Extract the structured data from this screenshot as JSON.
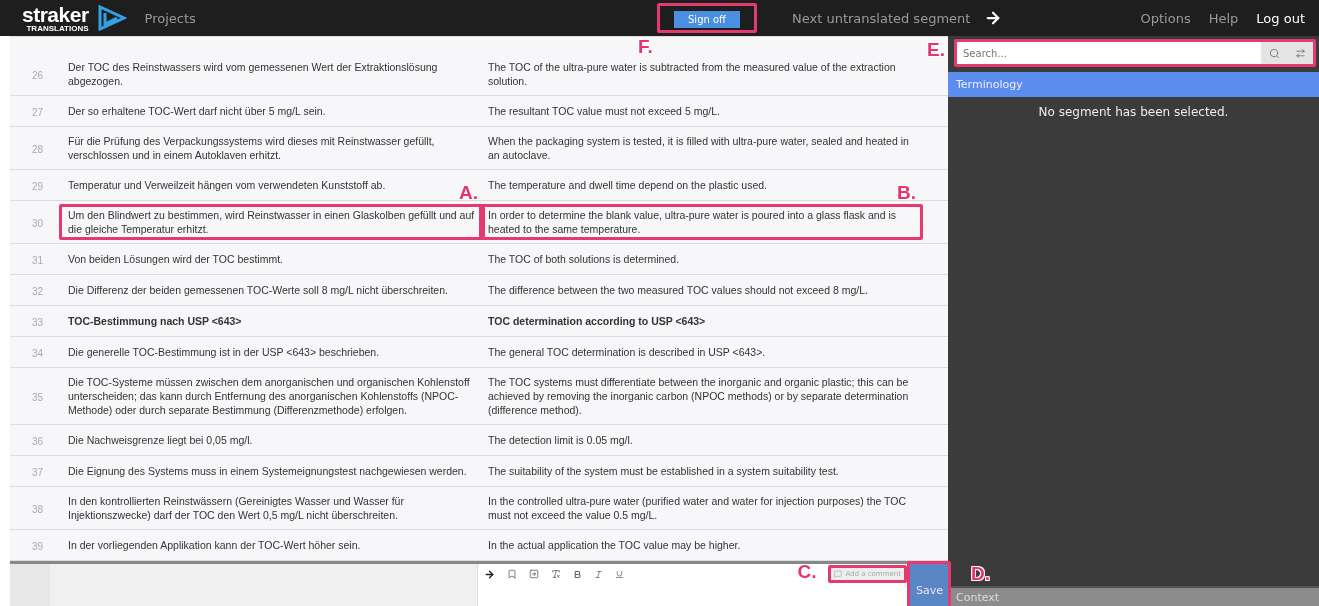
{
  "topbar": {
    "logo": {
      "name": "straker",
      "tagline": "TRANSLATIONS"
    },
    "projects": "Projects",
    "sign_off": {
      "label": "Sign off",
      "callout": "F."
    },
    "next": "Next untranslated segment",
    "menu": [
      {
        "label": "Options",
        "active": false
      },
      {
        "label": "Help",
        "active": false
      },
      {
        "label": "Log out",
        "active": true
      }
    ]
  },
  "segments": [
    {
      "number": "26",
      "source": "Der TOC des Reinstwassers wird vom gemessenen Wert der Extraktionslösung abgezogen.",
      "target": "The TOC of the ultra-pure water is subtracted from the measured value of the extraction solution.",
      "heading": false
    },
    {
      "number": "27",
      "source": "Der so erhaltene TOC-Wert darf nicht über 5 mg/L sein.",
      "target": "The resultant TOC value must not exceed 5 mg/L.",
      "heading": false
    },
    {
      "number": "28",
      "source": "Für die Prüfung des Verpackungssystems wird dieses mit Reinstwasser gefüllt, verschlossen und in einem Autoklaven erhitzt.",
      "target": "When the packaging system is tested, it is filled with ultra-pure water, sealed and heated in an autoclave.",
      "heading": false
    },
    {
      "number": "29",
      "source": "Temperatur und Verweilzeit hängen vom verwendeten Kunststoff ab.",
      "target": "The temperature and dwell time depend on the plastic used.",
      "heading": false
    },
    {
      "number": "30",
      "source": "Um den Blindwert zu bestimmen, wird Reinstwasser in einen Glaskolben gefüllt und auf die gleiche Temperatur erhitzt.",
      "target": "In order to determine the blank value, ultra-pure water is poured into a glass flask and is heated to the same temperature.",
      "heading": false,
      "source_callout": "A.",
      "target_callout": "B."
    },
    {
      "number": "31",
      "source": "Von beiden Lösungen wird der TOC bestimmt.",
      "target": "The TOC of both solutions is determined.",
      "heading": false
    },
    {
      "number": "32",
      "source": "Die Differenz der beiden gemessenen TOC-Werte soll 8 mg/L nicht überschreiten.",
      "target": "The difference between the two measured TOC values should not exceed 8 mg/L.",
      "heading": false
    },
    {
      "number": "33",
      "source": "TOC-Bestimmung nach USP <643>",
      "target": "TOC determination according to USP <643>",
      "heading": true
    },
    {
      "number": "34",
      "source": "Die generelle TOC-Bestimmung ist in der USP <643> beschrieben.",
      "target": "The general TOC determination is described in USP <643>.",
      "heading": false
    },
    {
      "number": "35",
      "source": "Die TOC-Systeme müssen zwischen dem anorganischen und organischen Kohlenstoff unterscheiden; das kann durch Entfernung des anorganischen Kohlenstoffs (NPOC-Methode) oder durch separate Bestimmung (Differenzmethode) erfolgen.",
      "target": "The TOC systems must differentiate between the inorganic and organic plastic; this can be achieved by removing the inorganic carbon (NPOC methods) or by separate determination (difference method).",
      "heading": false
    },
    {
      "number": "36",
      "source": "Die Nachweisgrenze liegt bei 0,05 mg/l.",
      "target": "The detection limit is 0.05 mg/l.",
      "heading": false
    },
    {
      "number": "37",
      "source": "Die Eignung des Systems muss in einem Systemeignungstest nachgewiesen werden.",
      "target": "The suitability of the system must be established in a system suitability test.",
      "heading": false
    },
    {
      "number": "38",
      "source": "In den kontrollierten Reinstwässern (Gereinigtes Wasser und Wasser für Injektionszwecke) darf der TOC den Wert 0,5 mg/L nicht überschreiten.",
      "target": "In the controlled ultra-pure water (purified water and water for injection purposes) the TOC must not exceed the value 0.5 mg/L.",
      "heading": false
    },
    {
      "number": "39",
      "source": "In der vorliegenden Applikation kann der TOC-Wert höher sein.",
      "target": "In the actual application the TOC value may be higher.",
      "heading": false
    }
  ],
  "editor": {
    "comment": {
      "placeholder": "Add a comment",
      "callout": "C."
    },
    "save": {
      "label": "Save",
      "callout": "D."
    }
  },
  "sidebar": {
    "search": {
      "placeholder": "Search...",
      "callout": "E."
    },
    "terminology": {
      "title": "Terminology",
      "message": "No segment has been selected."
    },
    "context": {
      "title": "Context"
    }
  }
}
